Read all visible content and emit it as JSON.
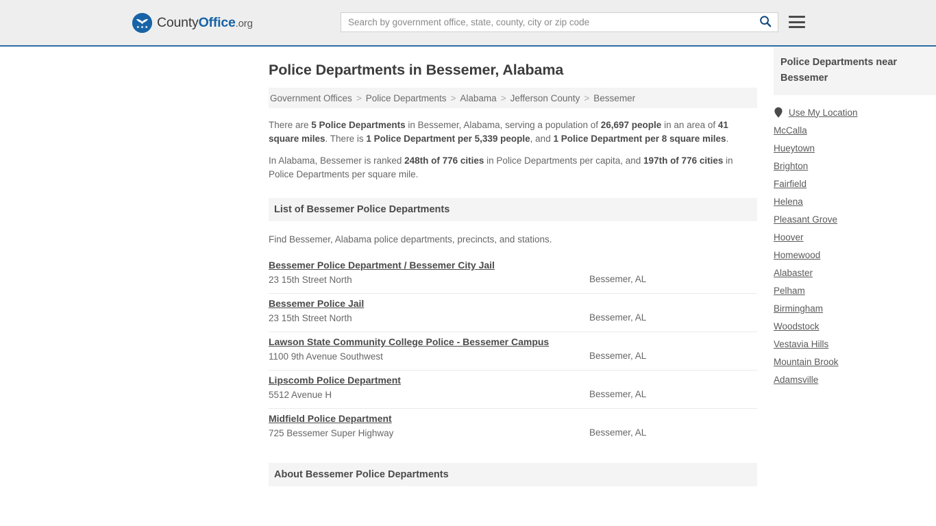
{
  "header": {
    "logo": {
      "icon": "eagle-shield-logo-icon",
      "part1": "County",
      "part2": "Office",
      "tld": ".org"
    },
    "search": {
      "placeholder": "Search by government office, state, county, city or zip code",
      "value": "",
      "button_icon": "search-icon"
    },
    "menu_icon": "hamburger-menu-icon"
  },
  "main": {
    "title": "Police Departments in Bessemer, Alabama",
    "breadcrumb": [
      "Government Offices",
      "Police Departments",
      "Alabama",
      "Jefferson County",
      "Bessemer"
    ],
    "breadcrumb_separator": ">",
    "intro": {
      "p1": [
        {
          "t": "There are ",
          "b": false
        },
        {
          "t": "5 Police Departments",
          "b": true
        },
        {
          "t": " in Bessemer, Alabama, serving a population of ",
          "b": false
        },
        {
          "t": "26,697 people",
          "b": true
        },
        {
          "t": " in an area of ",
          "b": false
        },
        {
          "t": "41 square miles",
          "b": true
        },
        {
          "t": ". There is ",
          "b": false
        },
        {
          "t": "1 Police Department per 5,339 people",
          "b": true
        },
        {
          "t": ", and ",
          "b": false
        },
        {
          "t": "1 Police Department per 8 square miles",
          "b": true
        },
        {
          "t": ".",
          "b": false
        }
      ],
      "p2": [
        {
          "t": "In Alabama, Bessemer is ranked ",
          "b": false
        },
        {
          "t": "248th of 776 cities",
          "b": true
        },
        {
          "t": " in Police Departments per capita, and ",
          "b": false
        },
        {
          "t": "197th of 776 cities",
          "b": true
        },
        {
          "t": " in Police Departments per square mile.",
          "b": false
        }
      ]
    },
    "list_section": {
      "heading": "List of Bessemer Police Departments",
      "subtext": "Find Bessemer, Alabama police departments, precincts, and stations.",
      "rows": [
        {
          "name": "Bessemer Police Department / Bessemer City Jail",
          "address": "23 15th Street North",
          "city": "Bessemer, AL"
        },
        {
          "name": "Bessemer Police Jail",
          "address": "23 15th Street North",
          "city": "Bessemer, AL"
        },
        {
          "name": "Lawson State Community College Police - Bessemer Campus",
          "address": "1100 9th Avenue Southwest",
          "city": "Bessemer, AL"
        },
        {
          "name": "Lipscomb Police Department",
          "address": "5512 Avenue H",
          "city": "Bessemer, AL"
        },
        {
          "name": "Midfield Police Department",
          "address": "725 Bessemer Super Highway",
          "city": "Bessemer, AL"
        }
      ]
    },
    "about_section": {
      "heading": "About Bessemer Police Departments"
    }
  },
  "sidebar": {
    "heading": "Police Departments near Bessemer",
    "use_my_location": {
      "icon": "map-pin-icon",
      "label": "Use My Location"
    },
    "nearby": [
      "McCalla",
      "Hueytown",
      "Brighton",
      "Fairfield",
      "Helena",
      "Pleasant Grove",
      "Hoover",
      "Homewood",
      "Alabaster",
      "Pelham",
      "Birmingham",
      "Woodstock",
      "Vestavia Hills",
      "Mountain Brook",
      "Adamsville"
    ]
  },
  "colors": {
    "brand_blue": "#1763a6",
    "header_bg": "#eeeeee",
    "header_rule": "#2b6ca3",
    "panel_bg": "#f4f4f4",
    "body_text": "#666666",
    "heading_text": "#4a4a4a"
  }
}
